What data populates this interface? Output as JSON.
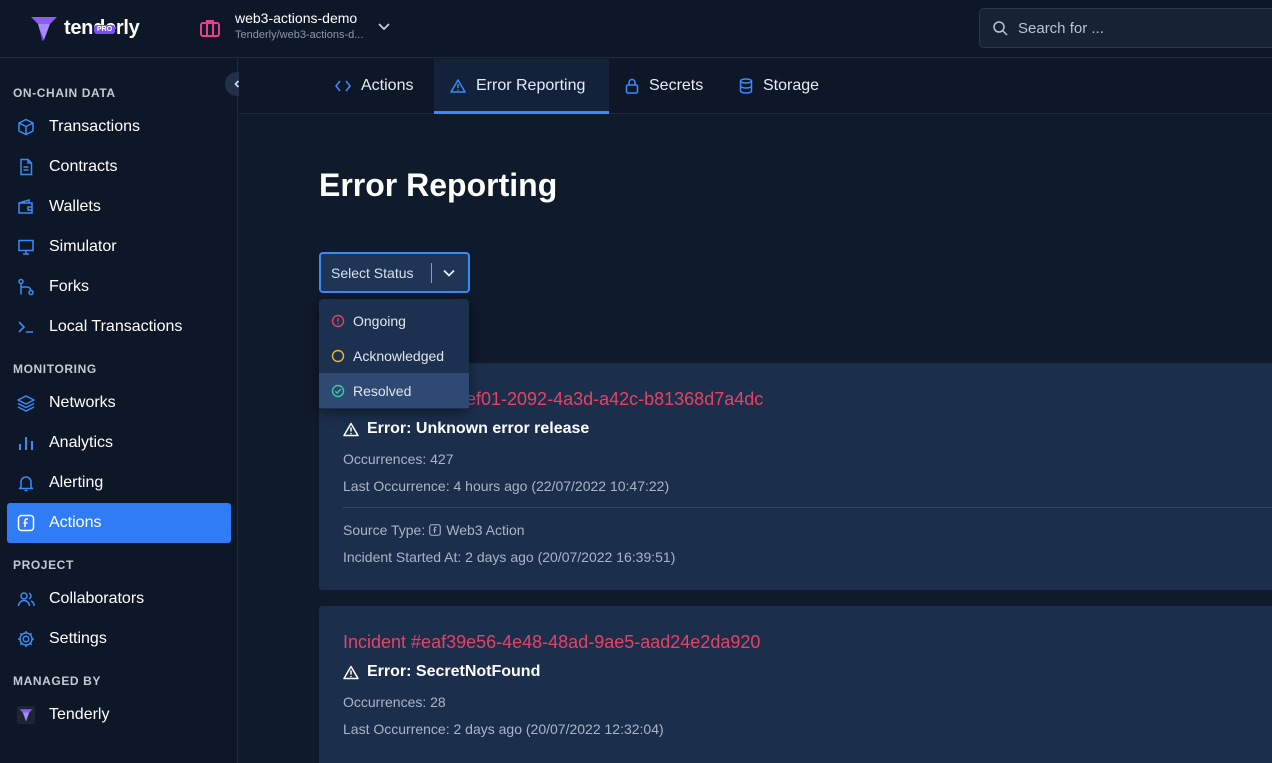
{
  "topbar": {
    "brand": "tenderly",
    "badge": "PRO",
    "project_name": "web3-actions-demo",
    "project_path": "Tenderly/web3-actions-d...",
    "search_placeholder": "Search for ..."
  },
  "sidebar": {
    "sections": {
      "onchain": "ON-CHAIN DATA",
      "monitoring": "MONITORING",
      "project": "PROJECT",
      "managed": "MANAGED BY"
    },
    "items": {
      "transactions": "Transactions",
      "contracts": "Contracts",
      "wallets": "Wallets",
      "simulator": "Simulator",
      "forks": "Forks",
      "local_transactions": "Local Transactions",
      "networks": "Networks",
      "analytics": "Analytics",
      "alerting": "Alerting",
      "actions": "Actions",
      "collaborators": "Collaborators",
      "settings": "Settings",
      "tenderly": "Tenderly"
    },
    "active_item": "Actions"
  },
  "tabs": {
    "actions": "Actions",
    "error_reporting": "Error Reporting",
    "secrets": "Secrets",
    "storage": "Storage",
    "active": "Error Reporting"
  },
  "main": {
    "title": "Error Reporting",
    "status_select": {
      "placeholder": "Select Status",
      "options": [
        "Ongoing",
        "Acknowledged",
        "Resolved"
      ],
      "highlighted": "Resolved"
    },
    "incidents": [
      {
        "id_visible": "ef01-2092-4a3d-a42c-b81368d7a4dc",
        "error": "Error: Unknown error release",
        "occurrences": "Occurrences: 427",
        "last_occurrence": "Last Occurrence: 4 hours ago (22/07/2022 10:47:22)",
        "source_type_label": "Source Type:",
        "source_type_value": "Web3 Action",
        "started": "Incident Started At: 2 days ago (20/07/2022 16:39:51)"
      },
      {
        "id_visible": "Incident #eaf39e56-4e48-48ad-9ae5-aad24e2da920",
        "error": "Error: SecretNotFound",
        "occurrences": "Occurrences: 28",
        "last_occurrence": "Last Occurrence: 2 days ago (20/07/2022 12:32:04)"
      }
    ]
  },
  "colors": {
    "accent": "#2f7cf6",
    "incident_red": "#e84263",
    "ongoing_red": "#e0445f",
    "acknowledged_yellow": "#e9b632",
    "resolved_green": "#3fc7a5",
    "card_bg": "#1b2f4d",
    "sidebar_bg": "#0e1727"
  }
}
